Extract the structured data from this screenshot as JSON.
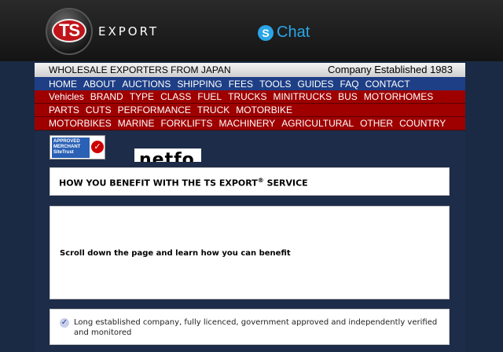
{
  "header": {
    "logo_mark": "TS",
    "logo_word": "EXPORT",
    "chat_label": "Chat",
    "skype_glyph": "S"
  },
  "strip": {
    "left": "WHOLESALE EXPORTERS FROM JAPAN",
    "right": "Company Established 1983"
  },
  "nav_main": [
    "HOME",
    "ABOUT",
    "AUCTIONS",
    "SHIPPING",
    "FEES",
    "TOOLS",
    "GUIDES",
    "FAQ",
    "CONTACT"
  ],
  "nav_row1": [
    "Vehicles",
    "BRAND",
    "TYPE",
    "CLASS",
    "FUEL",
    "TRUCKS",
    "MINITRUCKS",
    "BUS",
    "MOTORHOMES"
  ],
  "nav_row2": [
    "PARTS",
    "CUTS",
    "PERFORMANCE",
    "TRUCK",
    "MOTORBIKE"
  ],
  "nav_row3": [
    "MOTORBIKES",
    "MARINE",
    "FORKLIFTS",
    "MACHINERY",
    "AGRICULTURAL",
    "OTHER",
    "COUNTRY"
  ],
  "badge": {
    "text": "APPROVED MERCHANT SiteTrust",
    "check": "✓"
  },
  "netfo": "netfo",
  "panel_title": "HOW YOU BENEFIT WITH THE TS EXPORT",
  "panel_title_mark": "®",
  "panel_title_suffix": " SERVICE",
  "intro": "Scroll down the page and learn how you can benefit",
  "benefit_1": "Long established company, fully licenced, government approved and independently verified and monitored",
  "colors": {
    "nav_blue": "#1e3f86",
    "nav_red": "#9e0000",
    "logo_red": "#c0141a",
    "skype_blue": "#2aa6e8"
  },
  "icons": [
    "logo-icon",
    "skype-icon",
    "check-icon"
  ]
}
